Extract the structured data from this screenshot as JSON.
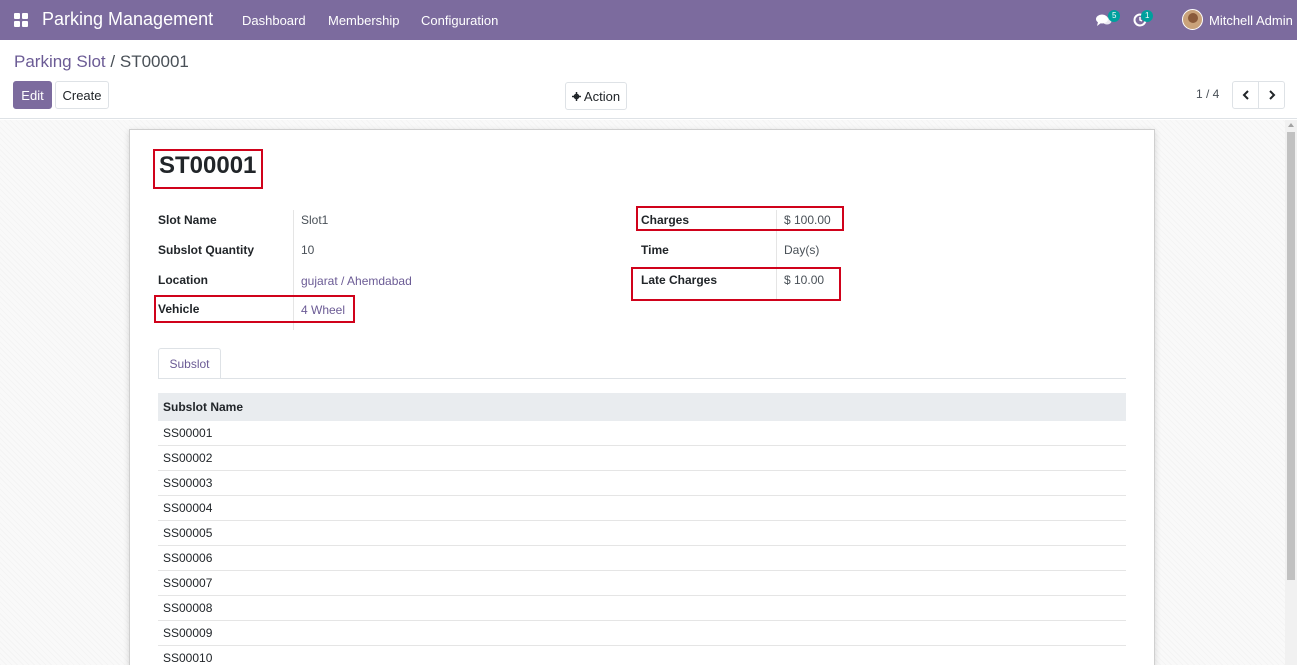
{
  "navbar": {
    "app_title": "Parking Management",
    "menus": [
      "Dashboard",
      "Membership",
      "Configuration"
    ],
    "messages_count": "5",
    "activities_count": "1",
    "user_name": "Mitchell Admin",
    "bg_color": "#7c6b9e"
  },
  "breadcrumb": {
    "parent": "Parking Slot",
    "separator": "/",
    "current": "ST00001"
  },
  "toolbar": {
    "edit_label": "Edit",
    "create_label": "Create",
    "action_label": "Action",
    "pager_value": "1 / 4"
  },
  "record": {
    "name": "ST00001",
    "left_fields": [
      {
        "label": "Slot Name",
        "value": "Slot1"
      },
      {
        "label": "Subslot Quantity",
        "value": "10"
      },
      {
        "label": "Location",
        "value": "gujarat / Ahemdabad"
      },
      {
        "label": "Vehicle",
        "value": "4 Wheel"
      }
    ],
    "right_fields": [
      {
        "label": "Charges",
        "value": "$ 100.00"
      },
      {
        "label": "Time",
        "value": "Day(s)"
      },
      {
        "label": "Late Charges",
        "value": "$ 10.00"
      }
    ]
  },
  "tabs": {
    "active": "Subslot"
  },
  "subslot_table": {
    "header": "Subslot Name",
    "rows": [
      "SS00001",
      "SS00002",
      "SS00003",
      "SS00004",
      "SS00005",
      "SS00006",
      "SS00007",
      "SS00008",
      "SS00009",
      "SS00010"
    ]
  },
  "colors": {
    "primary": "#7c6b9e",
    "highlight_box": "#d0021b",
    "link": "#6b5b95",
    "badge": "#00a09d"
  }
}
